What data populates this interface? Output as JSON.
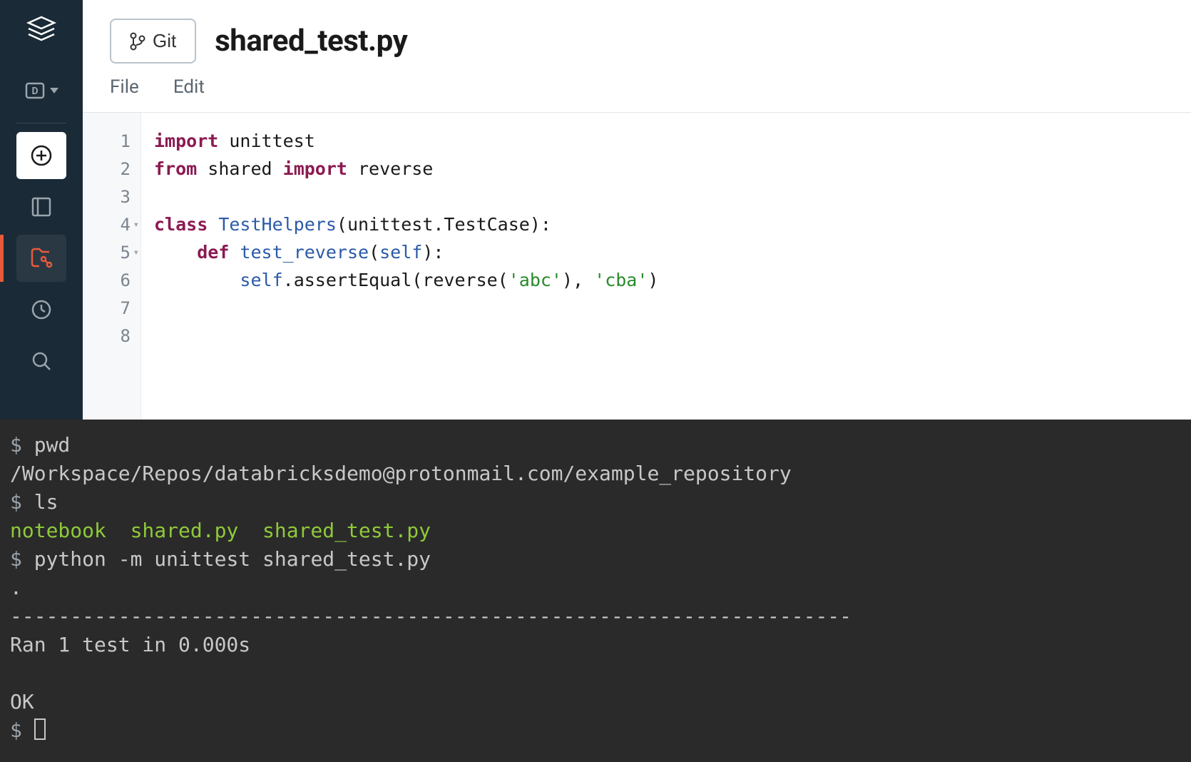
{
  "header": {
    "git_label": "Git",
    "file_title": "shared_test.py"
  },
  "menu": {
    "file": "File",
    "edit": "Edit"
  },
  "code": {
    "line1": {
      "kw1": "import",
      "rest": " unittest"
    },
    "line2": {
      "kw1": "from",
      "mid": " shared ",
      "kw2": "import",
      "rest": " reverse"
    },
    "line3": "",
    "line4": {
      "kw1": "class",
      "sp": " ",
      "cls": "TestHelpers",
      "rest": "(unittest.TestCase):"
    },
    "line5": {
      "indent": "    ",
      "kw1": "def",
      "sp": " ",
      "fn": "test_reverse",
      "lp": "(",
      "param": "self",
      "rp": "):"
    },
    "line6": {
      "indent": "        ",
      "self": "self",
      "method": ".assertEqual(reverse(",
      "s1": "'abc'",
      "mid": "), ",
      "s2": "'cba'",
      "end": ")"
    },
    "line7": "",
    "line8": ""
  },
  "line_numbers": [
    "1",
    "2",
    "3",
    "4",
    "5",
    "6",
    "7",
    "8"
  ],
  "fold_markers": {
    "4": "▾",
    "5": "▾"
  },
  "terminal": {
    "l1_prompt": "$ ",
    "l1_cmd": "pwd",
    "l2_out": "/Workspace/Repos/databricksdemo@protonmail.com/example_repository",
    "l3_prompt": "$ ",
    "l3_cmd": "ls",
    "l4_out": "notebook  shared.py  shared_test.py",
    "l5_prompt": "$ ",
    "l5_cmd": "python -m unittest shared_test.py",
    "l6_out": ".",
    "l7_out": "----------------------------------------------------------------------",
    "l8_out": "Ran 1 test in 0.000s",
    "l9_blank": "",
    "l10_out": "OK",
    "l11_prompt": "$ "
  }
}
